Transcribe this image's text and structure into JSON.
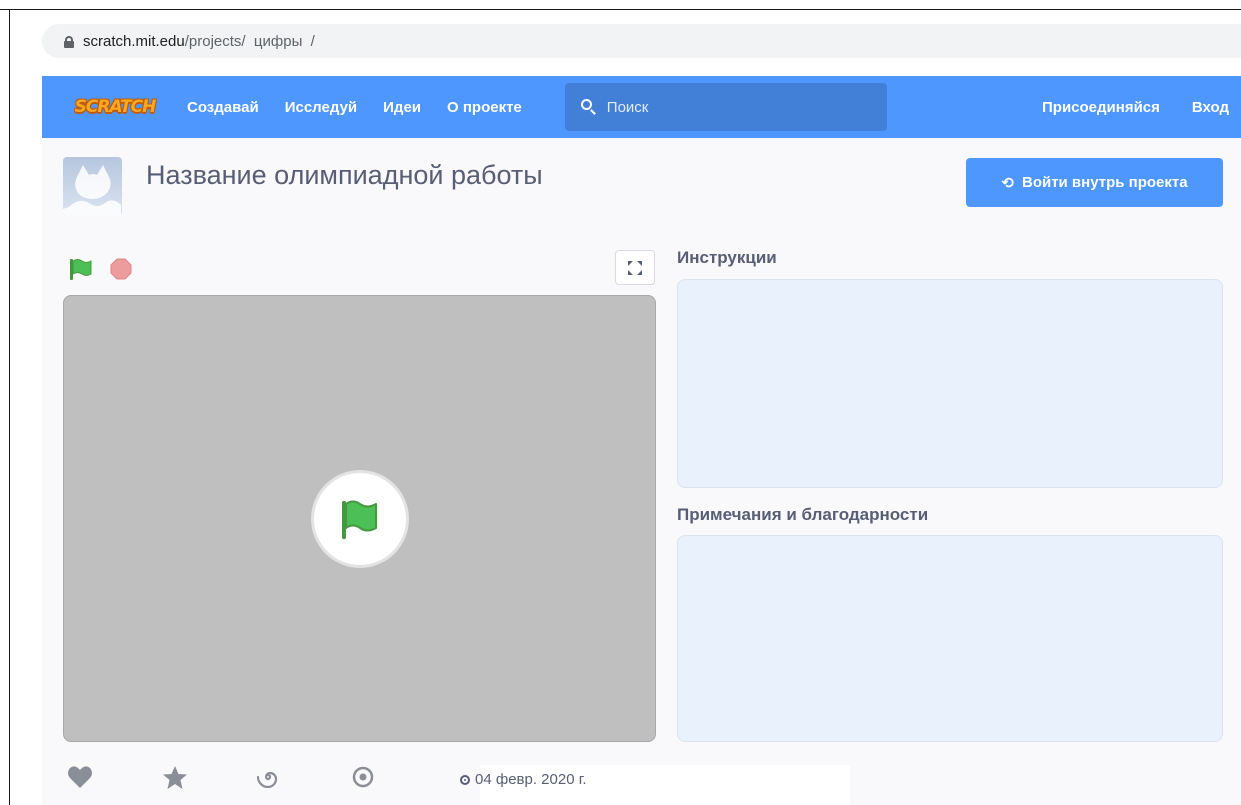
{
  "browser": {
    "url_host": "scratch.mit.edu",
    "url_path": "/projects/  цифры  /"
  },
  "nav": {
    "logo": "SCRATCH",
    "links": [
      "Создавай",
      "Исследуй",
      "Идеи",
      "О проекте"
    ],
    "search_placeholder": "Поиск",
    "join": "Присоединяйся",
    "signin": "Вход"
  },
  "project": {
    "title": "Название олимпиадной работы",
    "remix_label": "Войти внутрь проекта",
    "instructions_heading": "Инструкции",
    "notes_heading": "Примечания и благодарности",
    "date": "04 февр. 2020 г."
  },
  "colors": {
    "brand": "#4d97ff",
    "green_flag": "#4cbf56",
    "stop": "#ec9c9c"
  },
  "icons": {
    "lock": "lock-icon",
    "search": "search-icon",
    "remix": "remix-icon",
    "green_flag": "green-flag-icon",
    "stop": "stop-icon",
    "fullscreen": "fullscreen-icon",
    "love": "heart-icon",
    "favorite": "star-icon",
    "remix_count": "remix-spiral-icon",
    "views": "eye-icon"
  }
}
